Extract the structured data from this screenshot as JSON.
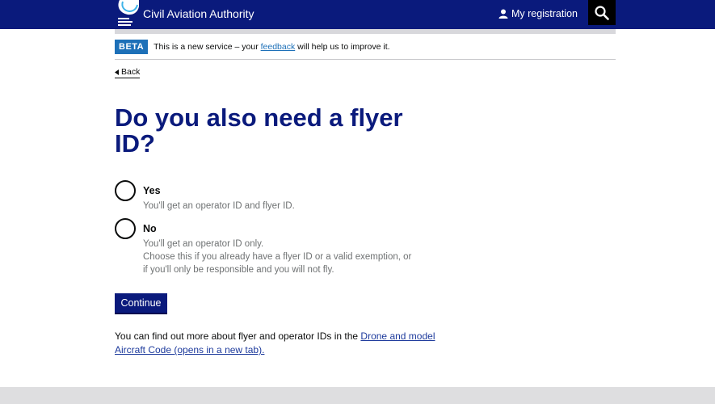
{
  "header": {
    "brand": "Civil Aviation Authority",
    "my_registration": "My registration",
    "icons": {
      "logo": "caa-logo-icon",
      "user": "user-icon",
      "search": "search-icon"
    },
    "colors": {
      "header_bg": "#0a1a7c",
      "search_bg": "#000000"
    }
  },
  "beta": {
    "tag": "BETA",
    "text_before": "This is a new service – your ",
    "link": "feedback",
    "text_after": " will help us to improve it."
  },
  "back": {
    "label": "Back",
    "icon": "triangle-left-icon"
  },
  "question": {
    "title": "Do you also need a flyer ID?",
    "options": [
      {
        "label": "Yes",
        "hints": [
          "You'll get an operator ID and flyer ID."
        ]
      },
      {
        "label": "No",
        "hints": [
          "You'll get an operator ID only.",
          "Choose this if you already have a flyer ID or a valid exemption, or",
          "if you'll only be responsible and you will not fly."
        ]
      }
    ]
  },
  "continue_label": "Continue",
  "footer": {
    "text": "You can find out more about flyer and operator IDs in the ",
    "link": "Drone and model Aircraft Code (opens in a new tab)."
  }
}
